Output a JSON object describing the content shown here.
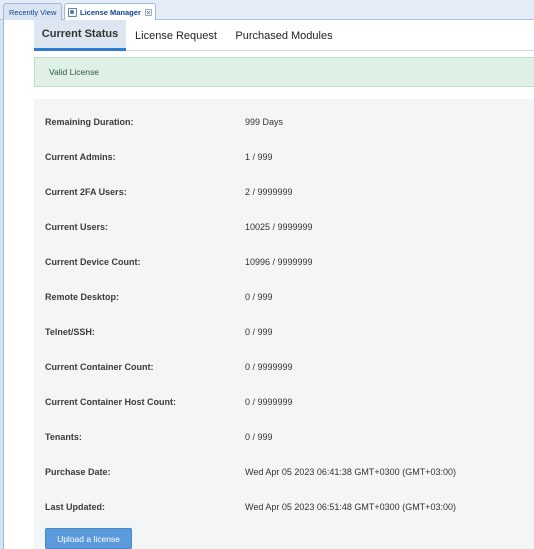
{
  "window_tabs": {
    "recent": "Recently View",
    "license_manager": "License Manager",
    "close_glyph": "×"
  },
  "status_tabs": [
    {
      "label": "Current Status",
      "active": true
    },
    {
      "label": "License Request",
      "active": false
    },
    {
      "label": "Purchased Modules",
      "active": false
    }
  ],
  "alert": {
    "text": "Valid License",
    "color": "#dff1e6"
  },
  "details": [
    {
      "label": "Remaining Duration:",
      "value": "999 Days"
    },
    {
      "label": "Current Admins:",
      "value": "1 / 999"
    },
    {
      "label": "Current 2FA Users:",
      "value": "2 / 9999999"
    },
    {
      "label": "Current Users:",
      "value": "10025 / 9999999"
    },
    {
      "label": "Current Device Count:",
      "value": "10996 / 9999999"
    },
    {
      "label": "Remote Desktop:",
      "value": "0 / 999"
    },
    {
      "label": "Telnet/SSH:",
      "value": "0 / 999"
    },
    {
      "label": "Current Container Count:",
      "value": "0 / 9999999"
    },
    {
      "label": "Current Container Host Count:",
      "value": "0 / 9999999"
    },
    {
      "label": "Tenants:",
      "value": "0 / 999"
    },
    {
      "label": "Purchase Date:",
      "value": "Wed Apr 05 2023 06:41:38 GMT+0300 (GMT+03:00)"
    },
    {
      "label": "Last Updated:",
      "value": "Wed Apr 05 2023 06:51:48 GMT+0300 (GMT+03:00)"
    }
  ],
  "upload_button": {
    "label": "Upload a license",
    "color": "#5b9bdc"
  },
  "accent_color": "#2f7cd6"
}
